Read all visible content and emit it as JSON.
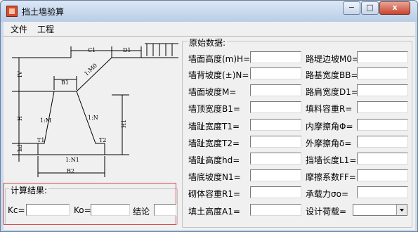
{
  "window": {
    "title": "挡土墙验算",
    "min": "−",
    "max": "□",
    "close": "x"
  },
  "menu": [
    "文件",
    "工程"
  ],
  "diagram": {
    "labels": {
      "C1": "C1",
      "D1": "D1",
      "M0": "1:M0",
      "B1": "B1",
      "IV": "IV",
      "H": "H",
      "M": "1:M",
      "N": "1:N",
      "H1": "H1",
      "T1": "T1",
      "T2": "T2",
      "hd": "hd",
      "N1": "1:N1",
      "B2": "B2"
    }
  },
  "raw_data": {
    "legend": "原始数据:",
    "fields_left": [
      {
        "label": "墙面高度(m)H=",
        "value": ""
      },
      {
        "label": "墙背坡度(±)N=",
        "value": ""
      },
      {
        "label": "墙面坡度M=",
        "value": ""
      },
      {
        "label": "墙顶宽度B1=",
        "value": ""
      },
      {
        "label": "墙趾宽度T1=",
        "value": ""
      },
      {
        "label": "墙趾宽度T2=",
        "value": ""
      },
      {
        "label": "墙趾高度hd=",
        "value": ""
      },
      {
        "label": "墙底坡度N1=",
        "value": ""
      },
      {
        "label": "砌体容重R1=",
        "value": ""
      },
      {
        "label": "填土高度A1=",
        "value": ""
      }
    ],
    "fields_right": [
      {
        "label": "路堤边坡M0=",
        "value": ""
      },
      {
        "label": "路基宽度BB=",
        "value": ""
      },
      {
        "label": "路肩宽度D1=",
        "value": ""
      },
      {
        "label": "填料容重R=",
        "value": ""
      },
      {
        "label": "内摩擦角Φ=",
        "value": ""
      },
      {
        "label": "外摩擦角δ=",
        "value": ""
      },
      {
        "label": "挡墙长度L1=",
        "value": ""
      },
      {
        "label": "摩擦系数FF=",
        "value": ""
      },
      {
        "label": "承载力σo=",
        "value": ""
      },
      {
        "label": "设计荷载=",
        "value": ""
      }
    ]
  },
  "results": {
    "legend": "计算结果:",
    "kc_label": "Kc=",
    "ko_label": "Ko=",
    "conclusion_label": "结论",
    "kc_value": "",
    "ko_value": "",
    "conclusion_value": ""
  }
}
